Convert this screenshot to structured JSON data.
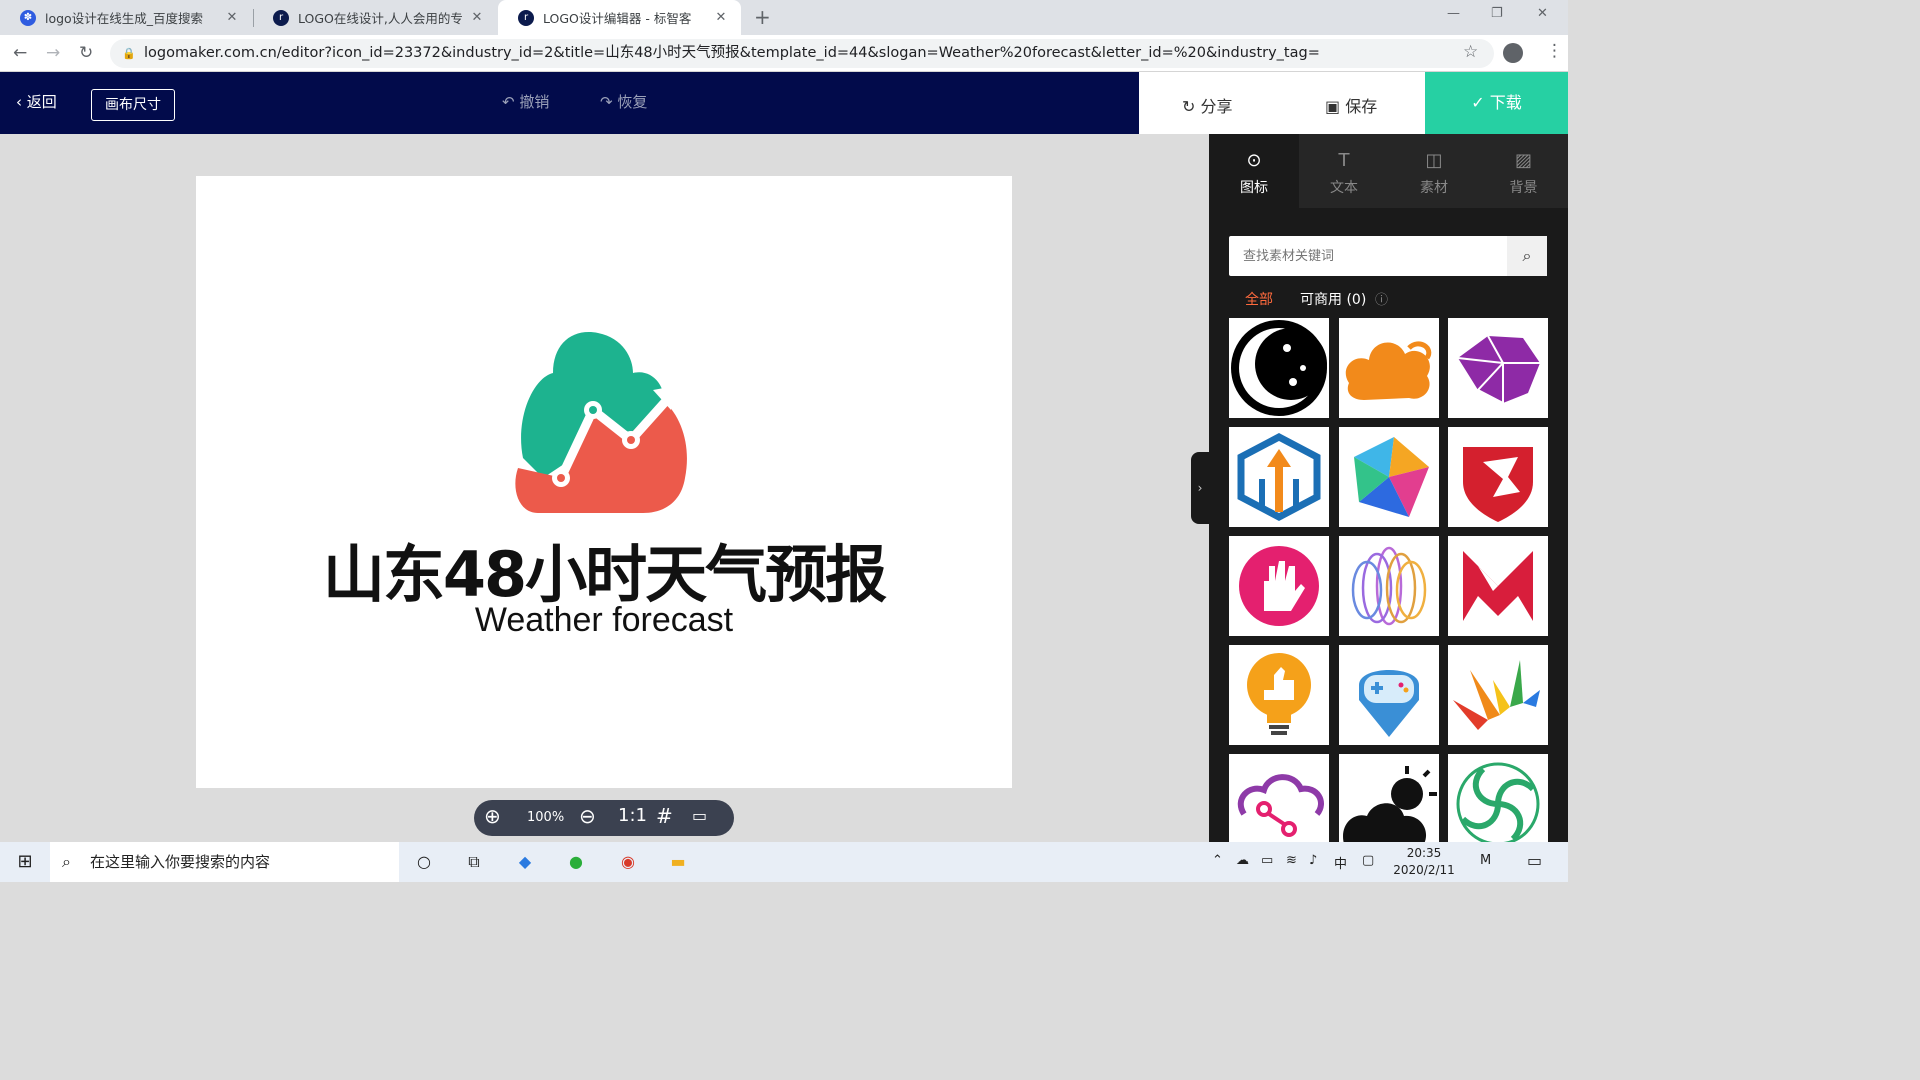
{
  "browser": {
    "tabs": [
      {
        "title": "logo设计在线生成_百度搜索",
        "favicon_color": "#2f5ce0",
        "active": false
      },
      {
        "title": "LOGO在线设计,人人会用的专业",
        "favicon_color": "#0c1b4d",
        "active": false
      },
      {
        "title": "LOGO设计编辑器 - 标智客",
        "favicon_color": "#0c1b4d",
        "active": true
      }
    ],
    "close_glyph": "✕",
    "new_tab_glyph": "+",
    "url": "logomaker.com.cn/editor?icon_id=23372&industry_id=2&title=山东48小时天气预报&template_id=44&slogan=Weather%20forecast&letter_id=%20&industry_tag="
  },
  "editor": {
    "back_label": "返回",
    "canvas_size_label": "画布尺寸",
    "undo_label": "撤销",
    "redo_label": "恢复",
    "share_label": "分享",
    "save_label": "保存",
    "download_label": "下载",
    "accent_color": "#26d0a3",
    "topbar_color": "#020b4b"
  },
  "logo": {
    "title": "山东48小时天气预报",
    "slogan": "Weather forecast",
    "colors": {
      "green": "#1db38f",
      "red": "#ec5a4b"
    }
  },
  "zoom": {
    "zoom_in_icon": "zoom-in-icon",
    "level": "100%",
    "zoom_out_icon": "zoom-out-icon",
    "ratio_label": "1:1",
    "grid_icon": "grid-icon",
    "ruler_icon": "ruler-icon"
  },
  "panel": {
    "tabs": [
      {
        "label": "图标",
        "icon": "target-icon",
        "active": true
      },
      {
        "label": "文本",
        "icon": "text-icon",
        "active": false
      },
      {
        "label": "素材",
        "icon": "shapes-icon",
        "active": false
      },
      {
        "label": "背景",
        "icon": "stripes-icon",
        "active": false
      }
    ],
    "search_placeholder": "查找素材关键词",
    "filter_all": "全部",
    "filter_commercial": "可商用 (0)",
    "filter_all_color": "#ff6a3d",
    "icons": [
      "moon-icon",
      "cloud-icon",
      "brain-icon",
      "hexagon-arrows-icon",
      "colorful-star-icon",
      "dragon-shield-icon",
      "hand-icon",
      "lotus-icon",
      "red-m-icon",
      "lightbulb-thumb-icon",
      "gamepad-pin-icon",
      "colorful-bars-icon",
      "cloud-network-icon",
      "sun-cloud-icon",
      "green-swirl-icon"
    ]
  },
  "taskbar": {
    "search_text": "在这里输入你要搜索的内容",
    "time": "20:35",
    "date": "2020/2/11",
    "ime": "中"
  }
}
